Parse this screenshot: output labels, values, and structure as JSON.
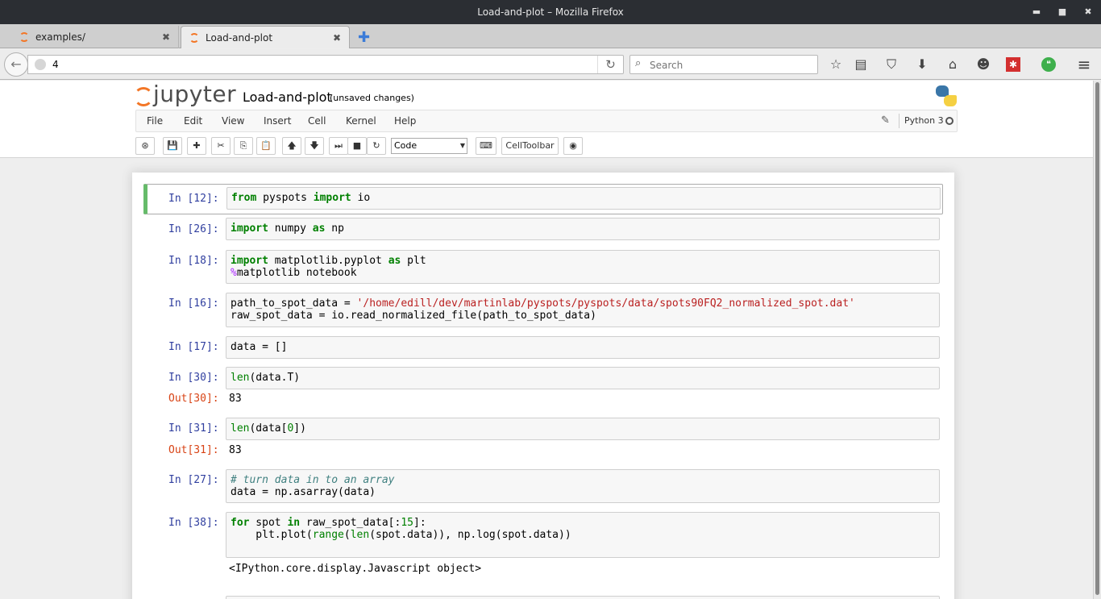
{
  "window": {
    "title": "Load-and-plot – Mozilla Firefox",
    "min": "▬",
    "max": "■",
    "close": "✖"
  },
  "tabs": [
    {
      "label": "examples/",
      "close": "✖"
    },
    {
      "label": "Load-and-plot",
      "close": "✖"
    }
  ],
  "newtab": "✚",
  "nav": {
    "back": "←",
    "url": "4",
    "reload": "↻",
    "search_placeholder": "Search",
    "search_icon": "⌕",
    "icons": [
      "☆",
      "▤",
      "⛉",
      "⬇",
      "⌂",
      "☻",
      "✱",
      "❝",
      "≡"
    ]
  },
  "jupyter": {
    "logo": "jupyter",
    "notebook_name": "Load-and-plot",
    "save_status": "(unsaved changes)",
    "menu": [
      "File",
      "Edit",
      "View",
      "Insert",
      "Cell",
      "Kernel",
      "Help"
    ],
    "kernel_name": "Python 3",
    "pencil": "✎",
    "toolbar": {
      "save": "💾",
      "add": "✚",
      "cut": "✂",
      "copy": "⎘",
      "paste": "📋",
      "up": "🡅",
      "down": "🡇",
      "run": "⏭",
      "stop": "■",
      "restart": "↻",
      "cell_type": "Code",
      "keyboard": "⌨",
      "celltoolbar": "CellToolbar",
      "github": "◉",
      "command": "⊛"
    }
  },
  "cells": [
    {
      "prompt": "In [12]:"
    },
    {
      "prompt": "In [26]:"
    },
    {
      "prompt": "In [18]:"
    },
    {
      "prompt": "In [16]:"
    },
    {
      "prompt": "In [17]:"
    },
    {
      "prompt": "In [30]:",
      "out_prompt": "Out[30]:",
      "output": "83"
    },
    {
      "prompt": "In [31]:",
      "out_prompt": "Out[31]:",
      "output": "83"
    },
    {
      "prompt": "In [27]:"
    },
    {
      "prompt": "In [38]:",
      "output": "<IPython.core.display.Javascript object>"
    }
  ],
  "code": {
    "c0": {
      "k1": "from",
      "t1": " pyspots ",
      "k2": "import",
      "t2": " io"
    },
    "c1": {
      "k1": "import",
      "t1": " numpy ",
      "k2": "as",
      "t2": " np"
    },
    "c2": {
      "k1": "import",
      "t1": " matplotlib.pyplot ",
      "k2": "as",
      "t2": " plt",
      "m": "%",
      "t3": "matplotlib notebook"
    },
    "c3": {
      "t1": "path_to_spot_data = ",
      "s": "'/home/edill/dev/martinlab/pyspots/pyspots/data/spots90FQ2_normalized_spot.dat'",
      "t2": "raw_spot_data = io.read_normalized_file(path_to_spot_data)"
    },
    "c4": {
      "t1": "data = []"
    },
    "c5": {
      "b": "len",
      "t1": "(data.T)"
    },
    "c6": {
      "b": "len",
      "t1": "(data[",
      "n": "0",
      "t2": "])"
    },
    "c7": {
      "cm": "# turn data in to an array",
      "t1": "data = np.asarray(data)"
    },
    "c8": {
      "k1": "for",
      "t1": " spot ",
      "k2": "in",
      "t2": " raw_spot_data[:",
      "n": "15",
      "t3": "]:",
      "t4": "    plt.plot(",
      "b1": "range",
      "t5": "(",
      "b2": "len",
      "t6": "(spot.data)), np.log(spot.data))"
    }
  }
}
